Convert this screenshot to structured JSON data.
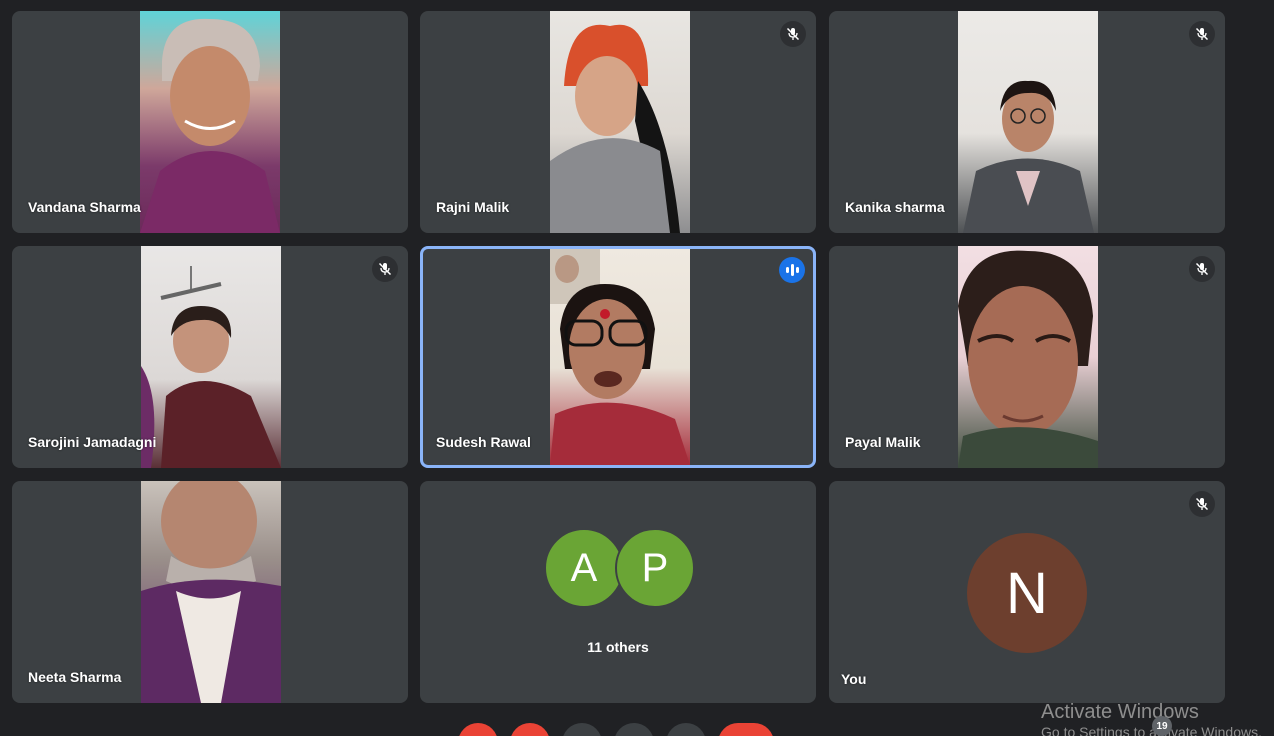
{
  "participants": [
    {
      "name": "Vandana Sharma",
      "muted": false
    },
    {
      "name": "Rajni Malik",
      "muted": true
    },
    {
      "name": "Kanika sharma",
      "muted": true
    },
    {
      "name": "Sarojini Jamadagni",
      "muted": true
    },
    {
      "name": "Sudesh Rawal",
      "speaking": true
    },
    {
      "name": "Payal Malik",
      "muted": true
    },
    {
      "name": "Neeta Sharma",
      "muted": false
    }
  ],
  "others_tile": {
    "avatars": [
      "A",
      "P"
    ],
    "label": "11 others"
  },
  "self_tile": {
    "initial": "N",
    "label": "You",
    "muted": true
  },
  "watermark": {
    "line1": "Activate Windows",
    "line2": "Go to Settings to activate Windows."
  },
  "taskbar": {
    "badge": "19"
  },
  "colors": {
    "background": "#202124",
    "tile": "#3c4043",
    "active_border": "#8ab4f8",
    "speaking": "#1a73e8",
    "avatar_green": "#6aa535",
    "avatar_self": "#6d3f2e",
    "end_call": "#ea4335"
  }
}
